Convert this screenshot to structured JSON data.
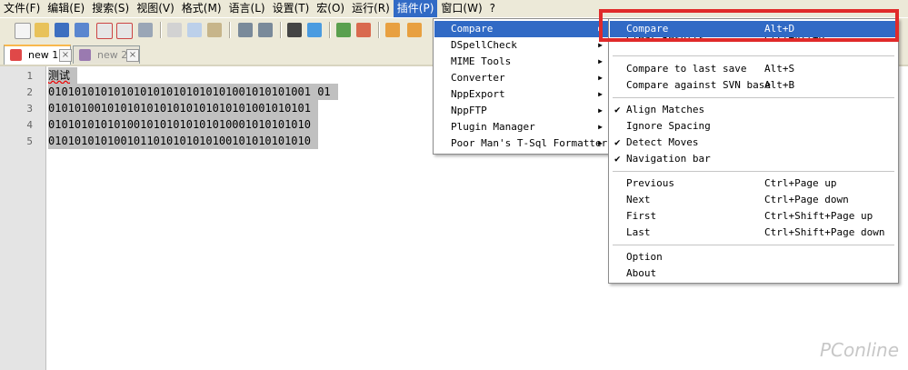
{
  "menubar": {
    "items": [
      "文件(F)",
      "编辑(E)",
      "搜索(S)",
      "视图(V)",
      "格式(M)",
      "语言(L)",
      "设置(T)",
      "宏(O)",
      "运行(R)",
      "插件(P)",
      "窗口(W)",
      "?"
    ],
    "active_index": 9
  },
  "tabs": [
    {
      "label": "new  1",
      "active": true
    },
    {
      "label": "new  2",
      "active": false
    }
  ],
  "editor": {
    "line_numbers": [
      "1",
      "2",
      "3",
      "4",
      "5"
    ],
    "lines": [
      "测试",
      "0101010101010101010101010101001010101001 01",
      "0101010010101010101010101010101001010101",
      "0101010101010010101010101010001010101010",
      "0101010101001011010101010100101010101010"
    ]
  },
  "plugins_menu": {
    "items": [
      {
        "label": "Compare",
        "submenu": true,
        "highlighted": true
      },
      {
        "label": "DSpellCheck",
        "submenu": true
      },
      {
        "label": "MIME Tools",
        "submenu": true
      },
      {
        "label": "Converter",
        "submenu": true
      },
      {
        "label": "NppExport",
        "submenu": true
      },
      {
        "label": "NppFTP",
        "submenu": true
      },
      {
        "label": "Plugin Manager",
        "submenu": true
      },
      {
        "label": "Poor Man's T-Sql Formatter",
        "submenu": true
      }
    ]
  },
  "compare_menu": {
    "items": [
      {
        "label": "Compare",
        "shortcut": "Alt+D",
        "highlighted": true
      },
      {
        "label": "Clear Results",
        "shortcut": "Ctrl+Alt+D"
      },
      {
        "sep": true
      },
      {
        "label": "Compare to last save",
        "shortcut": "Alt+S"
      },
      {
        "label": "Compare against SVN base",
        "shortcut": "Alt+B"
      },
      {
        "sep": true
      },
      {
        "label": "Align Matches",
        "checked": true
      },
      {
        "label": "Ignore Spacing"
      },
      {
        "label": "Detect Moves",
        "checked": true
      },
      {
        "label": "Navigation bar",
        "checked": true
      },
      {
        "sep": true
      },
      {
        "label": "Previous",
        "shortcut": "Ctrl+Page up"
      },
      {
        "label": "Next",
        "shortcut": "Ctrl+Page down"
      },
      {
        "label": "First",
        "shortcut": "Ctrl+Shift+Page up"
      },
      {
        "label": "Last",
        "shortcut": "Ctrl+Shift+Page down"
      },
      {
        "sep": true
      },
      {
        "label": "Option"
      },
      {
        "label": "About"
      }
    ]
  },
  "watermark": "PConline",
  "colors": {
    "highlight": "#316ac5",
    "annotation": "#e02a2a",
    "menubar_bg": "#ece9d8"
  }
}
